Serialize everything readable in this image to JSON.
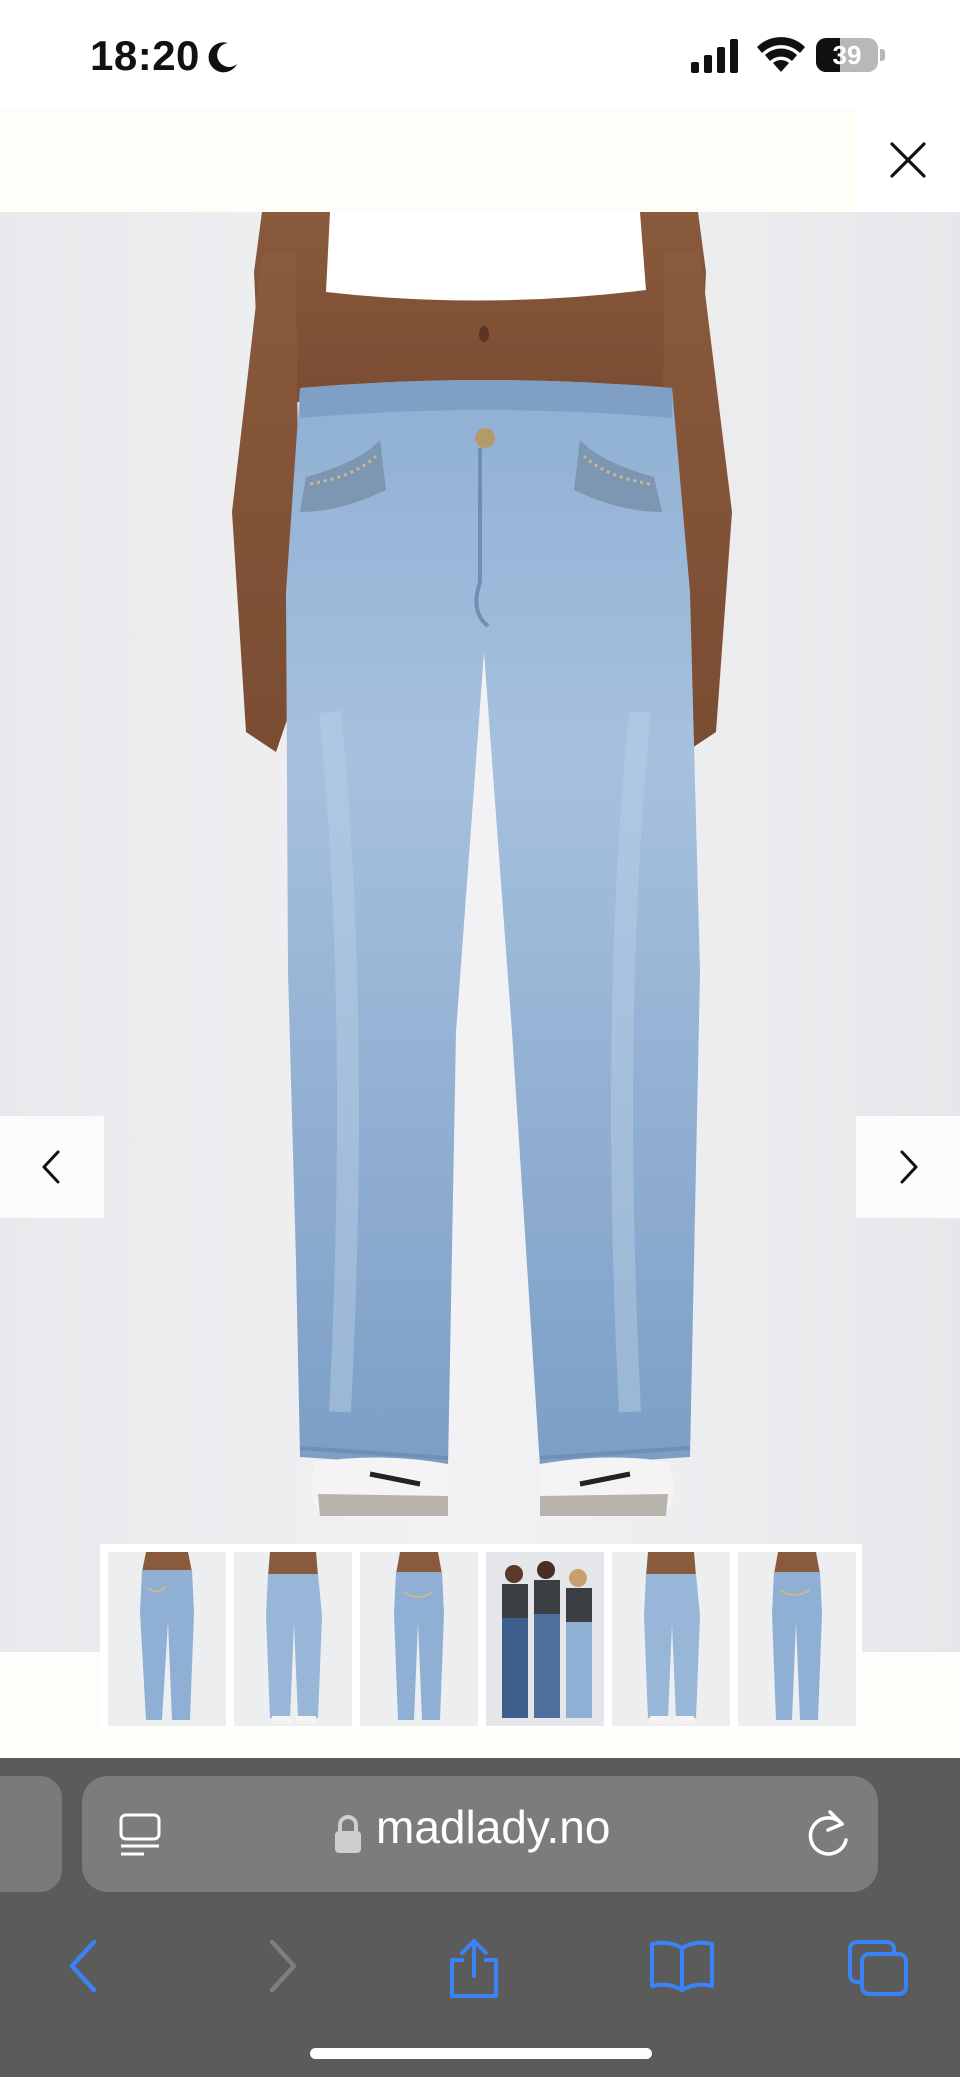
{
  "status_bar": {
    "time": "18:20",
    "battery_level": "39",
    "icons": [
      "moon-icon",
      "signal-icon",
      "wifi-icon",
      "battery-icon"
    ]
  },
  "header": {
    "close_icon": "close-icon"
  },
  "gallery": {
    "main_image": "light-wash bootcut jeans, front view",
    "prev_icon": "chevron-left-icon",
    "next_icon": "chevron-right-icon",
    "thumbnail_count": 6,
    "active_thumbnail": 5
  },
  "browser": {
    "url": "madlady.no",
    "icons": [
      "reader-icon",
      "lock-icon",
      "reload-icon",
      "back-icon",
      "forward-icon",
      "share-icon",
      "bookmarks-icon",
      "tabs-icon"
    ]
  },
  "colors": {
    "accent": "#3b82f6",
    "browser_bar": "#5b5b5b",
    "url_field": "#7c7c7c",
    "background": "#fefdf9"
  }
}
